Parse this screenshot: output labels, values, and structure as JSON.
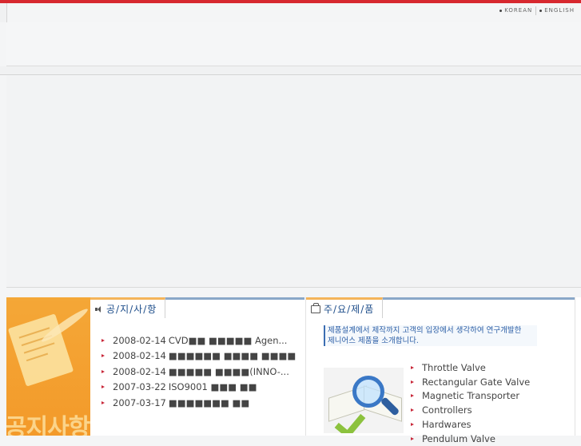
{
  "header": {
    "lang": [
      {
        "label": "KOREAN"
      },
      {
        "label": "ENGLISH"
      }
    ]
  },
  "side": {
    "big_text": "공지사항"
  },
  "notice": {
    "title": "공/지/사/항",
    "items": [
      {
        "date": "2008-02-14",
        "text": "CVD■■ ■■■■■  Agen..."
      },
      {
        "date": "2008-02-14",
        "text": "■■■■■■ ■■■■ ■■■■"
      },
      {
        "date": "2008-02-14",
        "text": "■■■■■ ■■■■(INNO-..."
      },
      {
        "date": "2007-03-22",
        "text": "ISO9001 ■■■ ■■"
      },
      {
        "date": "2007-03-17",
        "text": "■■■■■■■ ■■"
      }
    ]
  },
  "products": {
    "title": "주/요/제/품",
    "intro_line1": "제품설계에서 제작까지 고객의 입장에서 생각하여 연구개발한",
    "intro_line2": "제니어스 제품을 소개합니다.",
    "items": [
      {
        "label": "Throttle Valve"
      },
      {
        "label": "Rectangular Gate Valve"
      },
      {
        "label": "Magnetic Transporter"
      },
      {
        "label": "Controllers"
      },
      {
        "label": "Hardwares"
      },
      {
        "label": "Pendulum Valve"
      }
    ]
  },
  "colors": {
    "accent_red": "#d7282f",
    "tab_orange": "#f4b45a",
    "tab_blue": "#8aa7c8",
    "title_blue": "#1d4d8a"
  }
}
